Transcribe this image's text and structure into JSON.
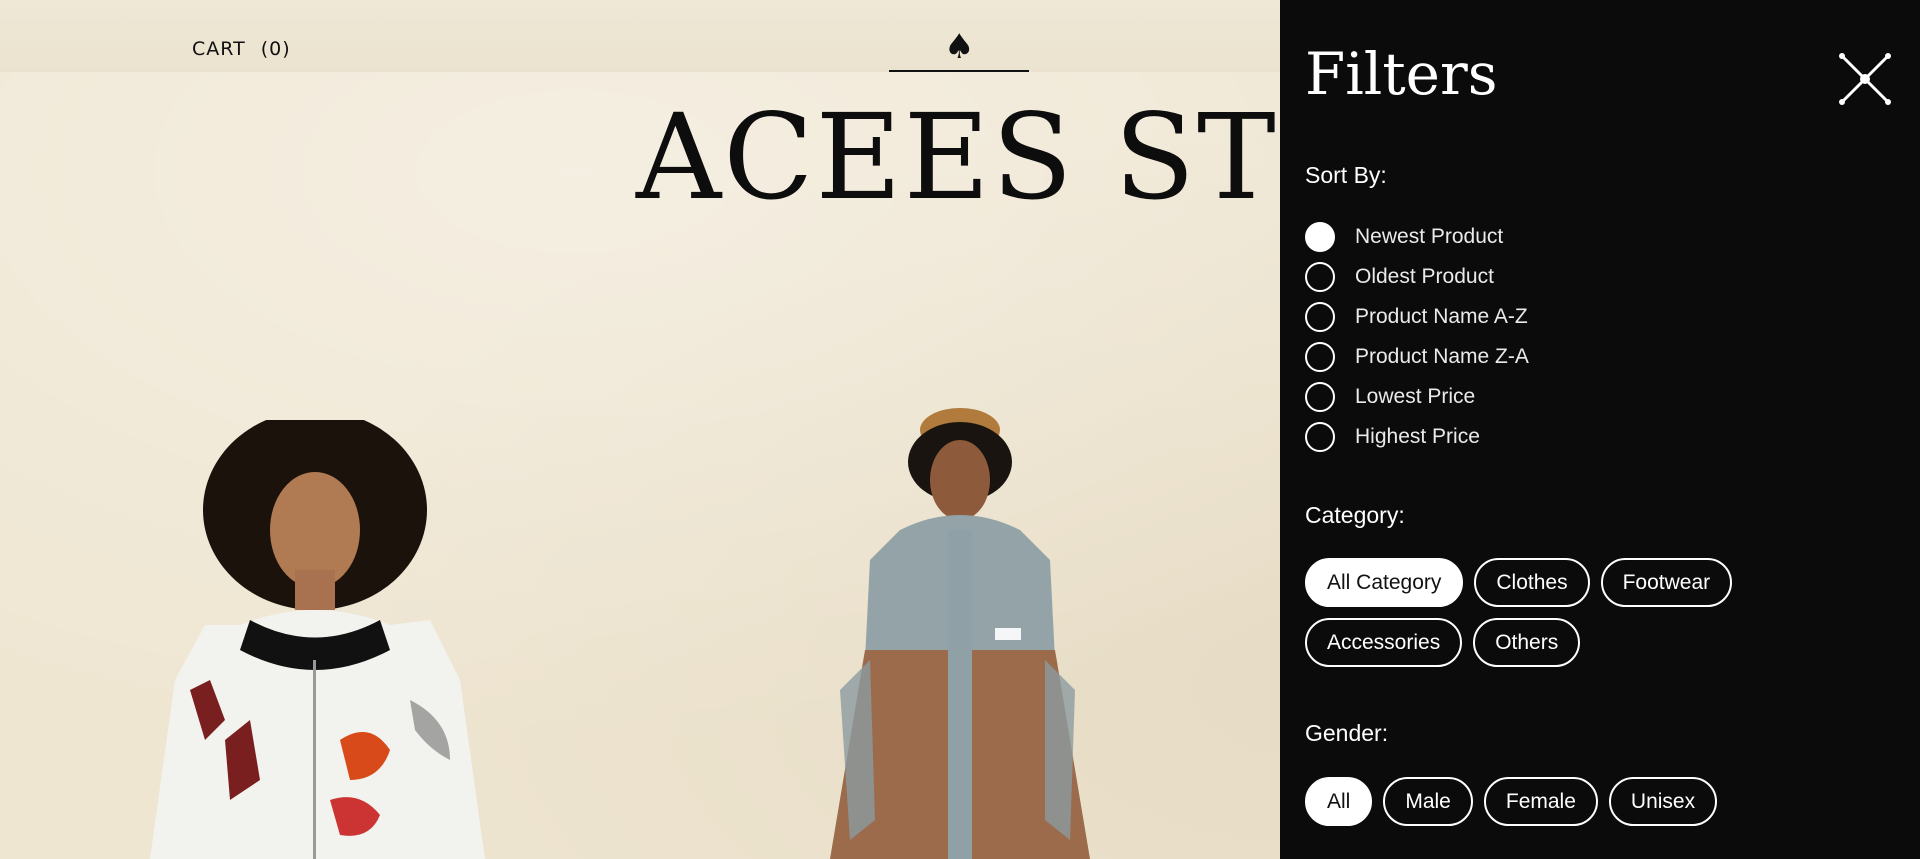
{
  "header": {
    "cart_label": "CART",
    "cart_count": "(0)",
    "logo_symbol": "♠",
    "store_title": "ACEES STORE"
  },
  "filters": {
    "title": "Filters",
    "sort_by_label": "Sort By:",
    "sort_options": [
      {
        "label": "Newest Product",
        "checked": true
      },
      {
        "label": "Oldest Product",
        "checked": false
      },
      {
        "label": "Product Name A-Z",
        "checked": false
      },
      {
        "label": "Product Name Z-A",
        "checked": false
      },
      {
        "label": "Lowest Price",
        "checked": false
      },
      {
        "label": "Highest Price",
        "checked": false
      }
    ],
    "category_label": "Category:",
    "categories": [
      {
        "label": "All Category",
        "active": true
      },
      {
        "label": "Clothes",
        "active": false
      },
      {
        "label": "Footwear",
        "active": false
      },
      {
        "label": "Accessories",
        "active": false
      },
      {
        "label": "Others",
        "active": false
      }
    ],
    "gender_label": "Gender:",
    "genders": [
      {
        "label": "All",
        "active": true
      },
      {
        "label": "Male",
        "active": false
      },
      {
        "label": "Female",
        "active": false
      },
      {
        "label": "Unisex",
        "active": false
      }
    ]
  },
  "icons": {
    "close": "close-icon",
    "spade": "spade-icon"
  },
  "colors": {
    "panel_bg": "#0b0b0b",
    "page_bg": "#efe6d2",
    "text_dark": "#111111",
    "text_light": "#ffffff"
  }
}
